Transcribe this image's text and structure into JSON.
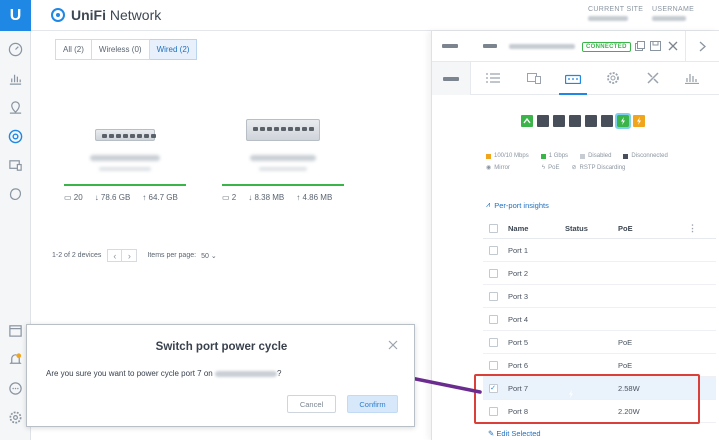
{
  "app": {
    "brand_prefix": "UniFi",
    "brand_suffix": "Network",
    "logo_letter": "U"
  },
  "header": {
    "current_site_label": "CURRENT SITE",
    "username_label": "USERNAME"
  },
  "filters": [
    {
      "label": "All (2)",
      "active": false
    },
    {
      "label": "Wireless (0)",
      "active": false
    },
    {
      "label": "Wired (2)",
      "active": true
    }
  ],
  "devices": [
    {
      "clients": "20",
      "download": "78.6 GB",
      "upload": "64.7 GB"
    },
    {
      "clients": "2",
      "download": "8.38 MB",
      "upload": "4.86 MB"
    }
  ],
  "pager": {
    "range": "1-2 of 2 devices",
    "per_page_label": "Items per page:",
    "per_page_value": "50"
  },
  "panel": {
    "status": "CONNECTED",
    "legend": {
      "speed_100": "100/10 Mbps",
      "speed_1g": "1 Gbps",
      "disabled": "Disabled",
      "disconnected": "Disconnected",
      "mirror": "Mirror",
      "poe": "PoE",
      "rstp": "RSTP Discarding"
    },
    "insights_label": "Per-port insights",
    "columns": {
      "name": "Name",
      "status": "Status",
      "poe": "PoE"
    },
    "ports": [
      {
        "name": "Port 1",
        "status": "up",
        "poe": "",
        "checked": false
      },
      {
        "name": "Port 2",
        "status": "down",
        "poe": "",
        "checked": false
      },
      {
        "name": "Port 3",
        "status": "down",
        "poe": "",
        "checked": false
      },
      {
        "name": "Port 4",
        "status": "down",
        "poe": "",
        "checked": false
      },
      {
        "name": "Port 5",
        "status": "down",
        "poe": "PoE",
        "checked": false
      },
      {
        "name": "Port 6",
        "status": "down",
        "poe": "PoE",
        "checked": false
      },
      {
        "name": "Port 7",
        "status": "poe-green",
        "poe": "2.58W",
        "checked": true
      },
      {
        "name": "Port 8",
        "status": "poe-yellow",
        "poe": "2.20W",
        "checked": false
      }
    ],
    "edit_selected": "Edit Selected"
  },
  "modal": {
    "title": "Switch port power cycle",
    "text_before": "Are you sure you want to power cycle port 7 on",
    "text_after": "?",
    "cancel": "Cancel",
    "confirm": "Confirm"
  },
  "colors": {
    "accent": "#1f88e5",
    "green": "#3bb44a",
    "yellow": "#f1a51d",
    "port_dark": "#484f5a",
    "highlight": "#d9403a",
    "arrow": "#6b2c8f"
  }
}
